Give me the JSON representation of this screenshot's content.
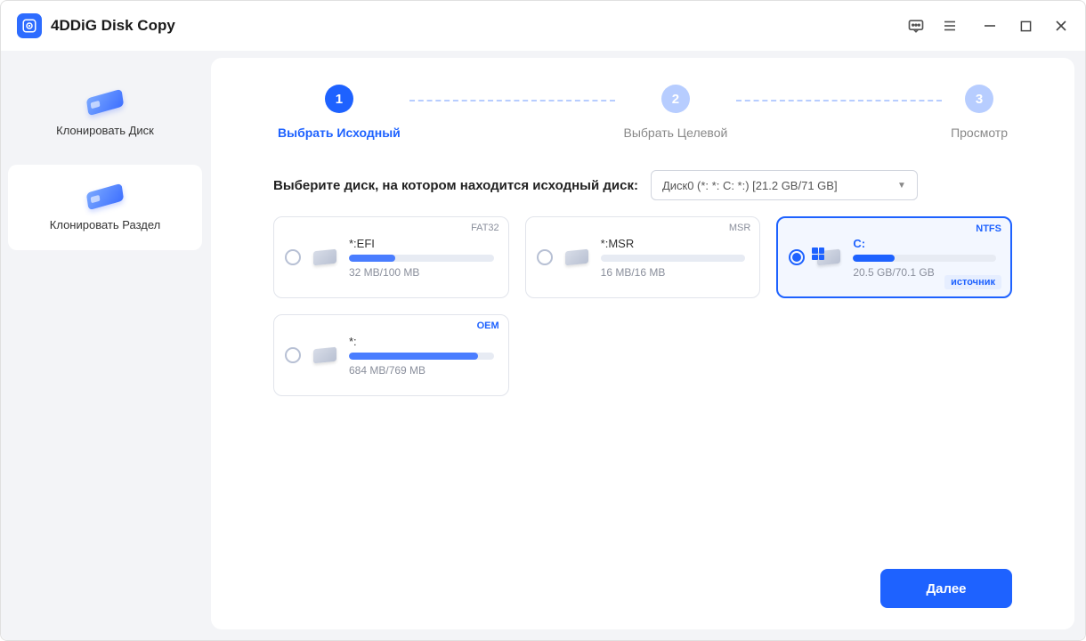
{
  "app": {
    "title": "4DDiG Disk Copy"
  },
  "window_controls": {
    "minimize": "minimize",
    "maximize": "maximize",
    "close": "close"
  },
  "sidebar": {
    "items": [
      {
        "label": "Клонировать Диск"
      },
      {
        "label": "Клонировать Раздел"
      }
    ]
  },
  "stepper": {
    "steps": [
      {
        "num": "1",
        "label": "Выбрать Исходный"
      },
      {
        "num": "2",
        "label": "Выбрать Целевой"
      },
      {
        "num": "3",
        "label": "Просмотр"
      }
    ]
  },
  "prompt": {
    "label": "Выберите диск, на котором находится исходный диск:",
    "selected": "Диск0 (*: *: C: *:) [21.2 GB/71 GB]"
  },
  "partitions": [
    {
      "name": "*:EFI",
      "fs": "FAT32",
      "size": "32 MB/100 MB",
      "fill_pct": 32,
      "selected": false
    },
    {
      "name": "*:MSR",
      "fs": "MSR",
      "size": "16 MB/16 MB",
      "fill_pct": 0,
      "selected": false
    },
    {
      "name": "C:",
      "fs": "NTFS",
      "size": "20.5 GB/70.1 GB",
      "fill_pct": 29,
      "selected": true,
      "source_tag": "источник"
    },
    {
      "name": "*:",
      "fs": "OEM",
      "size": "684 MB/769 MB",
      "fill_pct": 89,
      "selected": false
    }
  ],
  "footer": {
    "next": "Далее"
  }
}
